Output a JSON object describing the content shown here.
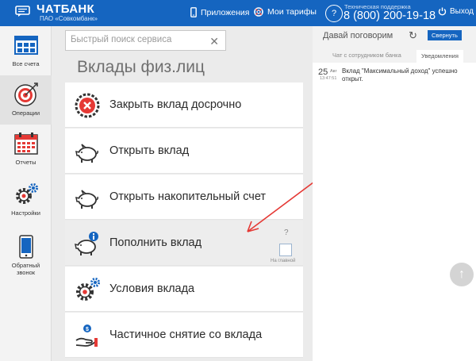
{
  "header": {
    "brand": "ЧАТБАНК",
    "brand_sub": "ПАО «Совкомбанк»",
    "apps_label": "Приложения",
    "tariffs_label": "Мои тарифы",
    "support_label": "Техническая поддержка",
    "support_phone": "8 (800) 200-19-18",
    "logout_label": "Выход",
    "color": "#1565c0"
  },
  "sidebar": {
    "items": [
      {
        "label": "Все счета",
        "icon": "accounts-grid-icon"
      },
      {
        "label": "Операции",
        "icon": "target-icon"
      },
      {
        "label": "Отчеты",
        "icon": "calendar-icon"
      },
      {
        "label": "Настройки",
        "icon": "settings-gears-icon"
      },
      {
        "label": "Обратный звонок",
        "icon": "phone-icon"
      }
    ],
    "active_index": 1
  },
  "search": {
    "placeholder": "Быстрый поиск сервиса"
  },
  "main": {
    "title": "Вклады физ.лиц",
    "items": [
      {
        "label": "Закрыть вклад досрочно",
        "icon": "close-deposit-icon"
      },
      {
        "label": "Открыть вклад",
        "icon": "piggy-bank-icon"
      },
      {
        "label": "Открыть накопительный счет",
        "icon": "piggy-bank-icon"
      },
      {
        "label": "Пополнить вклад",
        "icon": "piggy-bank-info-icon"
      },
      {
        "label": "Условия вклада",
        "icon": "settings-gear-icon"
      },
      {
        "label": "Частичное снятие со вклада",
        "icon": "hand-withdraw-icon"
      }
    ],
    "hovered_index": 3,
    "help": "?",
    "home_label": "На главной"
  },
  "chat": {
    "title": "Давай поговорим",
    "collapse_label": "Свернуть",
    "tabs": [
      "Чат с сотрудником банка",
      "Уведомления"
    ],
    "active_tab": 1,
    "notification": {
      "day": "25",
      "month": "Авг",
      "time": "13:47:51",
      "text": "Вклад \"Максимальный доход\" успешно открыт."
    }
  },
  "annotation": {
    "arrow_color": "#e53935"
  }
}
